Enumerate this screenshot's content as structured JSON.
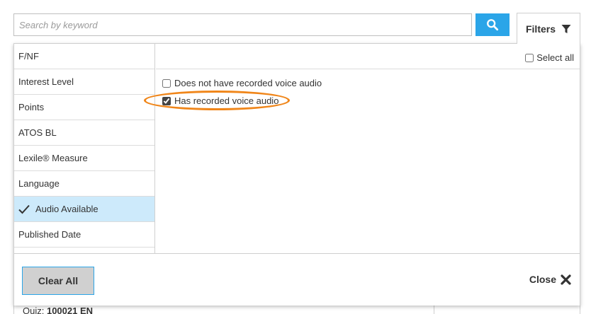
{
  "search": {
    "placeholder": "Search by keyword",
    "value": "",
    "button_icon": "search-icon"
  },
  "filters_tab": {
    "label": "Filters",
    "icon": "funnel-icon"
  },
  "categories": [
    {
      "label": "F/NF",
      "active": false
    },
    {
      "label": "Interest Level",
      "active": false
    },
    {
      "label": "Points",
      "active": false
    },
    {
      "label": "ATOS BL",
      "active": false
    },
    {
      "label": "Lexile® Measure",
      "active": false
    },
    {
      "label": "Language",
      "active": false
    },
    {
      "label": "Audio Available",
      "active": true
    },
    {
      "label": "Published Date",
      "active": false
    }
  ],
  "options": {
    "select_all_label": "Select all",
    "items": [
      {
        "label": "Does not have recorded voice audio",
        "checked": false
      },
      {
        "label": "Has recorded voice audio",
        "checked": true
      }
    ]
  },
  "footer": {
    "clear_all_label": "Clear All",
    "close_label": "Close"
  },
  "background": {
    "quiz_prefix": "Quiz:",
    "quiz_number": "100021 EN"
  },
  "colors": {
    "accent_blue": "#2ba5e8",
    "active_row": "#cdeafb",
    "highlight_orange": "#f0861a"
  }
}
